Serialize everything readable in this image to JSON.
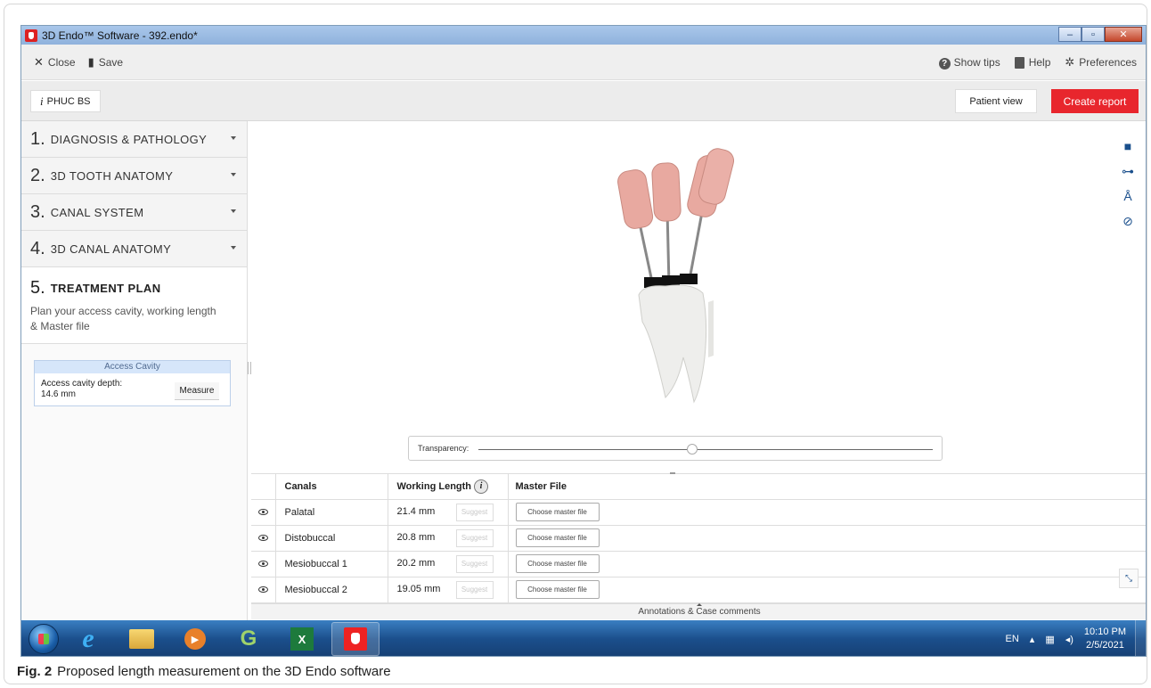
{
  "window": {
    "title": "3D Endo™ Software - 392.endo*"
  },
  "toolbar": {
    "close_label": "Close",
    "save_label": "Save",
    "show_tips_label": "Show tips",
    "help_label": "Help",
    "preferences_label": "Preferences"
  },
  "patient": {
    "name": "PHUC BS",
    "patient_view_label": "Patient view",
    "create_report_label": "Create report"
  },
  "steps": [
    {
      "num": "1.",
      "label": "DIAGNOSIS & PATHOLOGY"
    },
    {
      "num": "2.",
      "label": "3D TOOTH ANATOMY"
    },
    {
      "num": "3.",
      "label": "CANAL SYSTEM"
    },
    {
      "num": "4.",
      "label": "3D CANAL ANATOMY"
    },
    {
      "num": "5.",
      "label": "TREATMENT PLAN",
      "description": "Plan your access cavity, working length & Master file"
    }
  ],
  "access_cavity": {
    "header": "Access Cavity",
    "depth_label": "Access cavity depth:",
    "depth_value": "14.6 mm",
    "measure_label": "Measure"
  },
  "viewport": {
    "transparency_label": "Transparency:",
    "transparency_level": 0.47
  },
  "canals": {
    "headers": {
      "canals": "Canals",
      "working_length": "Working Length",
      "master_file": "Master File"
    },
    "suggest_label": "Suggest",
    "choose_label": "Choose master file",
    "rows": [
      {
        "name": "Palatal",
        "length": "21.4 mm"
      },
      {
        "name": "Distobuccal",
        "length": "20.8 mm"
      },
      {
        "name": "Mesiobuccal 1",
        "length": "20.2 mm"
      },
      {
        "name": "Mesiobuccal 2",
        "length": "19.05 mm"
      }
    ]
  },
  "annotations_label": "Annotations & Case comments",
  "taskbar": {
    "language": "EN",
    "time": "10:10 PM",
    "date": "2/5/2021"
  },
  "caption": {
    "fig": "Fig. 2",
    "text": "Proposed length measurement on the 3D Endo software"
  },
  "colors": {
    "accent_red": "#e8262d",
    "tool_blue": "#1a4f8c"
  }
}
